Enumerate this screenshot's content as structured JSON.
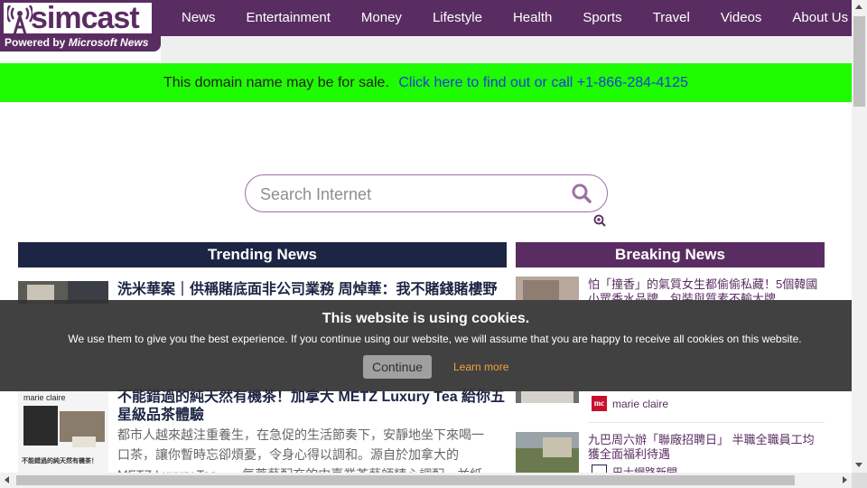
{
  "header": {
    "logo_text": "simcast",
    "powered_prefix": "Powered by",
    "powered_brand": "Microsoft News",
    "nav": [
      "News",
      "Entertainment",
      "Money",
      "Lifestyle",
      "Health",
      "Sports",
      "Travel",
      "Videos",
      "About Us"
    ]
  },
  "banner": {
    "text": "This domain name may be for sale.",
    "link": "Click here to find out or call +1-866-284-4125",
    "color": "#1ffb00"
  },
  "search": {
    "placeholder": "Search Internet",
    "search_icon": "search-icon",
    "zoom_icon": "zoom-in-icon"
  },
  "trending": {
    "heading": "Trending News",
    "articles": [
      {
        "title": "洗米華案｜供稱賭底面非公司業務 周焯華：我不賭錢賭樓野"
      },
      {
        "title": "不能錯過的純天然有機茶！加拿大 METZ Luxury Tea 給你五星級品茶體驗",
        "body": "都市人越來越注重養生，在急促的生活節奏下，安靜地坐下來喝一口茶，讓你暫時忘卻煩憂，令身心得以調和。源自於加拿大的 METZ Luxury Tea，一氣萃藝配充的中嘉業茶藝師精心調配，並紙本在的日",
        "thumb_caption": "marie claire",
        "thumb_text": "不能錯過的純天然有機茶！"
      }
    ]
  },
  "breaking": {
    "heading": "Breaking News",
    "items": [
      {
        "title": "怕「撞香」的氣質女生都偷偷私藏！5個韓國小眾香水品牌，包裝與質素不輸大牌"
      },
      {
        "title": "",
        "source": "marie claire",
        "source_logo": "mc"
      },
      {
        "title": "九巴周六辦「聯廠招聘日」 半職全職員工均獲全面福利待遇",
        "source": "巴士網路新聞"
      }
    ]
  },
  "cookie": {
    "title": "This website is using cookies.",
    "message": "We use them to give you the best experience. If you continue using our website, we will assume that you are happy to receive all cookies on this website.",
    "continue": "Continue",
    "learn_more": "Learn more"
  }
}
